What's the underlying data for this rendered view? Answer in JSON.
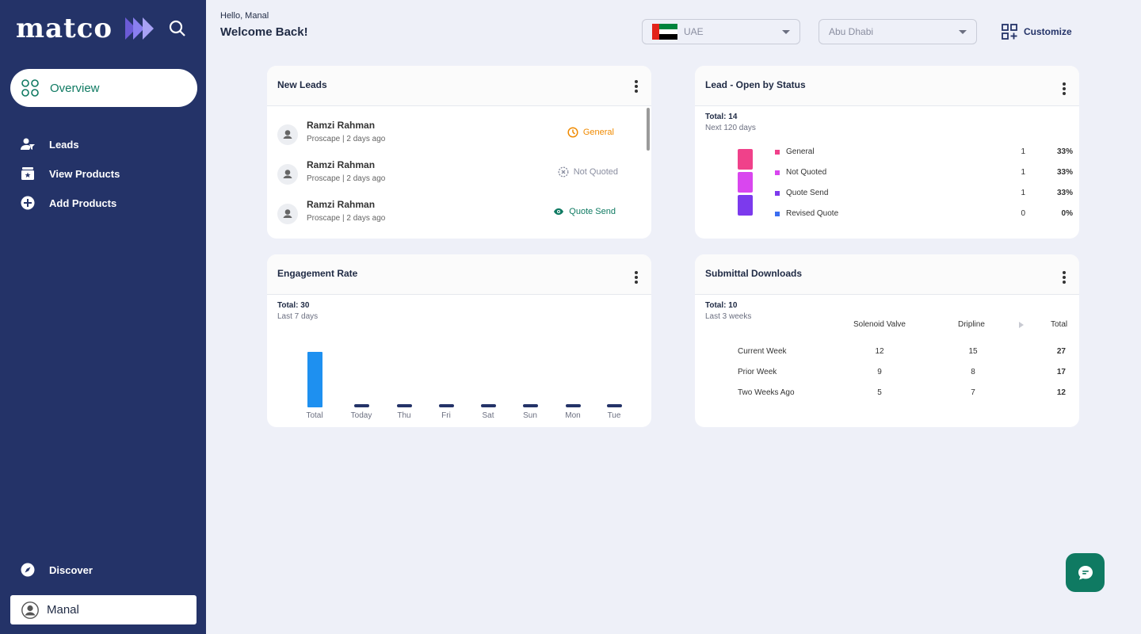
{
  "brand": {
    "name": "matco"
  },
  "sidebar": {
    "overview": "Overview",
    "items": [
      {
        "label": "Leads"
      },
      {
        "label": "View Products"
      },
      {
        "label": "Add Products"
      }
    ],
    "discover": "Discover",
    "user": "Manal"
  },
  "header": {
    "hello": "Hello, Manal",
    "welcome": "Welcome Back!",
    "country": "UAE",
    "city": "Abu Dhabi",
    "customize": "Customize"
  },
  "new_leads": {
    "title": "New Leads",
    "items": [
      {
        "name": "Ramzi Rahman",
        "meta": "Proscape | 2 days ago",
        "status": "General",
        "status_color": "#f08a00"
      },
      {
        "name": "Ramzi Rahman",
        "meta": " Proscape | 2 days ago",
        "status": "Not Quoted",
        "status_color": "#8a8ea0"
      },
      {
        "name": "Ramzi Rahman",
        "meta": "Proscape | 2 days ago",
        "status": "Quote Send",
        "status_color": "#0f7a62"
      }
    ]
  },
  "lead_status": {
    "title": "Lead - Open by Status",
    "total": "Total: 14",
    "period": "Next 120 days",
    "rows": [
      {
        "label": "General",
        "count": "1",
        "pct": "33%",
        "color": "#f0418a"
      },
      {
        "label": "Not Quoted",
        "count": "1",
        "pct": "33%",
        "color": "#d946ef"
      },
      {
        "label": "Quote Send",
        "count": "1",
        "pct": "33%",
        "color": "#7c3aed"
      },
      {
        "label": "Revised Quote",
        "count": "0",
        "pct": "0%",
        "color": "#3b6df0"
      }
    ]
  },
  "engagement": {
    "title": "Engagement Rate",
    "total": "Total: 30",
    "period": "Last 7 days"
  },
  "chart_data": {
    "type": "bar",
    "categories": [
      "Total",
      "Today",
      "Thu",
      "Fri",
      "Sat",
      "Sun",
      "Mon",
      "Tue"
    ],
    "values": [
      30,
      0,
      0,
      0,
      0,
      0,
      0,
      0
    ],
    "colors": {
      "total": "#1e90f0",
      "other": "#243368"
    },
    "ylim": [
      0,
      30
    ],
    "grid": false
  },
  "submittal": {
    "title": "Submittal Downloads",
    "total": "Total: 10",
    "period": "Last 3 weeks",
    "columns": [
      "Solenoid Valve",
      "Dripline",
      "Total"
    ],
    "rows": [
      {
        "label": "Current Week",
        "values": [
          "12",
          "15",
          "27"
        ]
      },
      {
        "label": "Prior Week",
        "values": [
          "9",
          "8",
          "17"
        ]
      },
      {
        "label": "Two Weeks Ago",
        "values": [
          "5",
          "7",
          "12"
        ]
      }
    ]
  }
}
